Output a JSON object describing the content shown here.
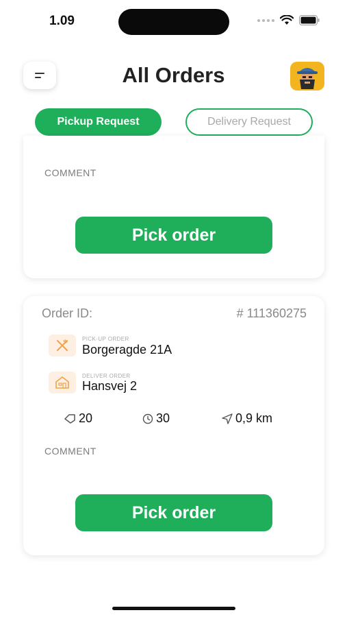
{
  "status_bar": {
    "time": "1.09"
  },
  "header": {
    "title": "All Orders",
    "menu_icon": "menu-icon",
    "avatar_icon": "avatar-pirate-icon"
  },
  "tabs": [
    {
      "label": "Pickup Request",
      "active": true
    },
    {
      "label": "Delivery Request",
      "active": false
    }
  ],
  "orders": [
    {
      "comment_label": "COMMENT",
      "button_label": "Pick order"
    },
    {
      "order_id_label": "Order ID:",
      "order_id": "# 111360275",
      "pickup": {
        "small_label": "PICK-UP ORDER",
        "address": "Borgeragde 21A",
        "icon": "utensils-icon"
      },
      "delivery": {
        "small_label": "DELIVER ORDER",
        "address": "Hansvej 2",
        "icon": "house-icon"
      },
      "stats": [
        {
          "icon": "tag-icon",
          "value": "20"
        },
        {
          "icon": "clock-icon",
          "value": "30"
        },
        {
          "icon": "navigation-arrow-icon",
          "value": "0,9 km"
        }
      ],
      "comment_label": "COMMENT",
      "button_label": "Pick order"
    }
  ],
  "colors": {
    "accent": "#1fae5a",
    "icon_bg": "#fdf0e2",
    "icon_fg": "#f0a24a"
  }
}
